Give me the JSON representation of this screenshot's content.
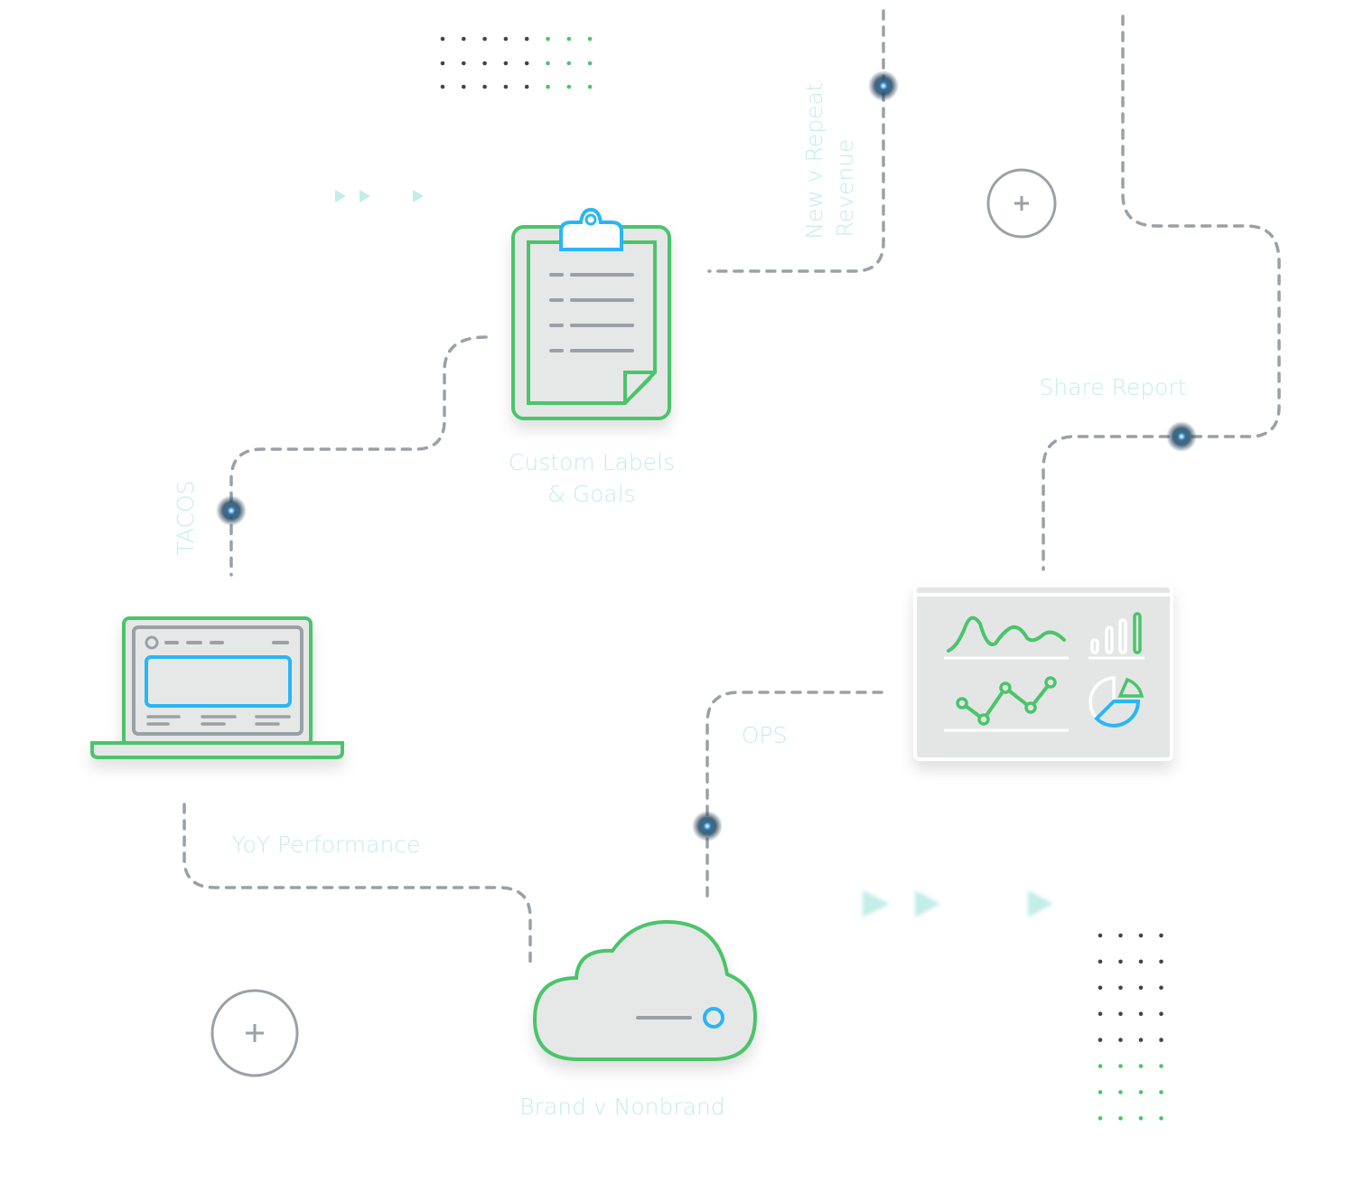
{
  "labels": {
    "custom_labels_1": "Custom Labels",
    "custom_labels_2": "& Goals",
    "share_report": "Share Report",
    "tacos": "TACOS",
    "new_v_repeat_1": "New v Repeat",
    "new_v_repeat_2": "Revenue",
    "ops": "OPS",
    "yoy": "YoY Performance",
    "brand": "Brand v Nonbrand"
  },
  "icons": [
    "clipboard-icon",
    "laptop-icon",
    "cloud-icon",
    "dashboard-icon",
    "plus-icon"
  ],
  "colors": {
    "green": "#4cc46a",
    "blue": "#29b6f6",
    "gray": "#9aa1a6",
    "label": "#c3ede8",
    "node": "#1f5f8b",
    "fill": "#e6e8e8"
  }
}
